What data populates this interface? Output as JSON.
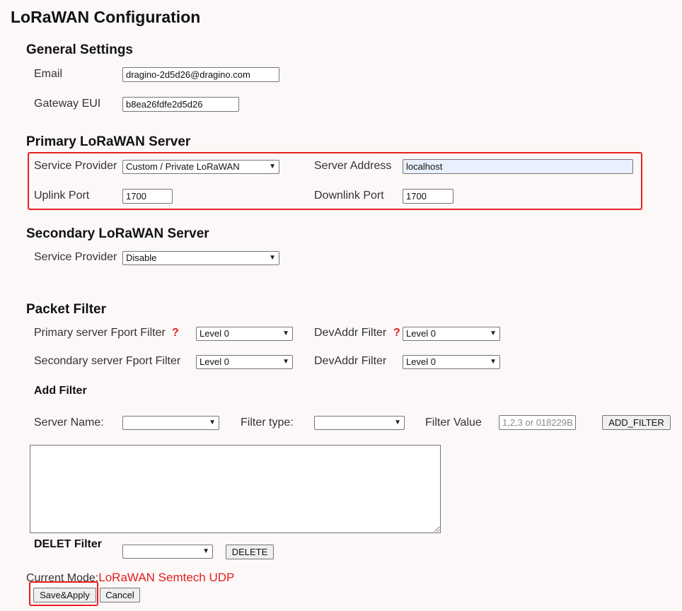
{
  "page": {
    "title": "LoRaWAN Configuration"
  },
  "general": {
    "heading": "General Settings",
    "email_label": "Email",
    "email_value": "dragino-2d5d26@dragino.com",
    "gateway_eui_label": "Gateway EUI",
    "gateway_eui_value": "b8ea26fdfe2d5d26"
  },
  "primary": {
    "heading": "Primary LoRaWAN Server",
    "service_provider_label": "Service Provider",
    "service_provider_value": "Custom / Private LoRaWAN",
    "server_address_label": "Server Address",
    "server_address_value": "localhost",
    "uplink_port_label": "Uplink Port",
    "uplink_port_value": "1700",
    "downlink_port_label": "Downlink Port",
    "downlink_port_value": "1700"
  },
  "secondary": {
    "heading": "Secondary LoRaWAN Server",
    "service_provider_label": "Service Provider",
    "service_provider_value": "Disable"
  },
  "packet_filter": {
    "heading": "Packet Filter",
    "primary_fport_label": "Primary server Fport Filter",
    "primary_fport_value": "Level 0",
    "primary_devaddr_label": "DevAddr Filter",
    "primary_devaddr_value": "Level 0",
    "secondary_fport_label": "Secondary server Fport Filter",
    "secondary_fport_value": "Level 0",
    "secondary_devaddr_label": "DevAddr Filter",
    "secondary_devaddr_value": "Level 0",
    "help_glyph": "?"
  },
  "add_filter": {
    "heading": "Add Filter",
    "server_name_label": "Server Name:",
    "server_name_value": "",
    "filter_type_label": "Filter type:",
    "filter_type_value": "",
    "filter_value_label": "Filter Value",
    "filter_value_placeholder": "1,2,3 or 018229B",
    "add_button": "ADD_FILTER",
    "filter_list_value": ""
  },
  "delete_filter": {
    "heading": "DELET Filter",
    "select_value": "",
    "delete_button": "DELETE"
  },
  "footer": {
    "current_mode_label": "Current Mode:",
    "current_mode_value": "LoRaWAN Semtech UDP",
    "save_button": "Save&Apply",
    "cancel_button": "Cancel"
  },
  "colors": {
    "highlight": "#e8201e",
    "mode_text": "#e02020",
    "background": "#fdf8f8"
  },
  "icons": {
    "help": "question-mark-icon",
    "dropdown": "chevron-down-icon"
  }
}
